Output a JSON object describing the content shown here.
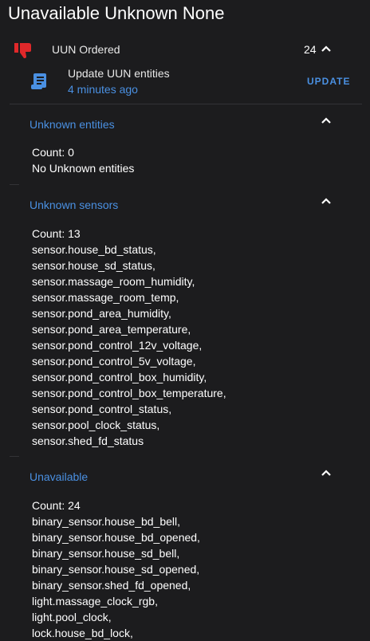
{
  "card": {
    "title": "Unavailable Unknown None"
  },
  "header": {
    "label": "UUN Ordered",
    "count": "24"
  },
  "update": {
    "title": "Update UUN entities",
    "time": "4 minutes ago",
    "button": "UPDATE"
  },
  "sections": [
    {
      "title": "Unknown entities",
      "count_text": "Count: 0",
      "items": [
        "No Unknown entities"
      ]
    },
    {
      "title": "Unknown sensors",
      "count_text": "Count: 13",
      "items": [
        "sensor.house_bd_status,",
        "sensor.house_sd_status,",
        "sensor.massage_room_humidity,",
        "sensor.massage_room_temp,",
        "sensor.pond_area_humidity,",
        "sensor.pond_area_temperature,",
        "sensor.pond_control_12v_voltage,",
        "sensor.pond_control_5v_voltage,",
        "sensor.pond_control_box_humidity,",
        "sensor.pond_control_box_temperature,",
        "sensor.pond_control_status,",
        "sensor.pool_clock_status,",
        "sensor.shed_fd_status"
      ]
    },
    {
      "title": "Unavailable",
      "count_text": "Count: 24",
      "items": [
        "binary_sensor.house_bd_bell,",
        "binary_sensor.house_bd_opened,",
        "binary_sensor.house_sd_bell,",
        "binary_sensor.house_sd_opened,",
        "binary_sensor.shed_fd_opened,",
        "light.massage_clock_rgb,",
        "light.pool_clock,",
        "lock.house_bd_lock,"
      ]
    }
  ],
  "colors": {
    "accent": "#4a90e2",
    "thumb": "#e0282a",
    "background": "#1c1c1e"
  },
  "icons": {
    "header": "thumb-down-icon",
    "script": "script-text-icon",
    "collapse": "chevron-up-icon"
  }
}
